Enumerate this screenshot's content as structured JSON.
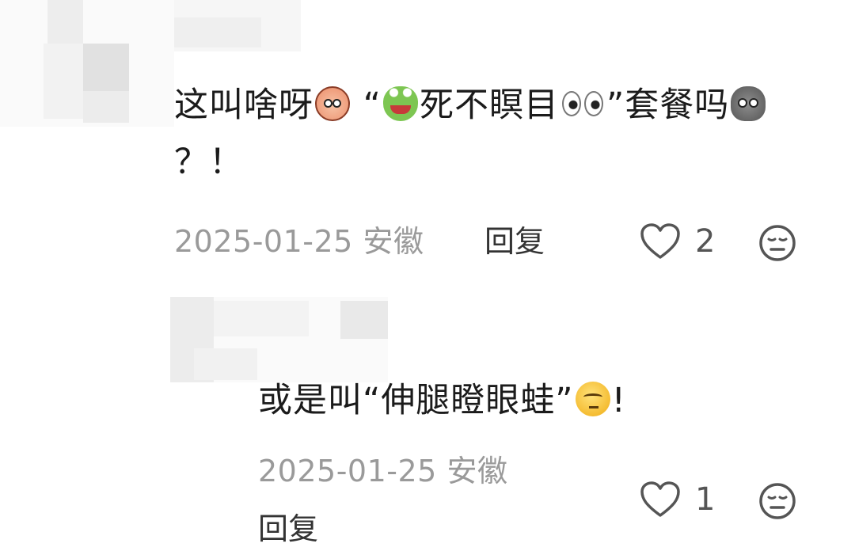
{
  "comments": [
    {
      "text_part1": "这叫啥呀",
      "text_part2": "“",
      "text_part3": "死不瞑目",
      "text_part4": "”套餐吗",
      "text_part5": "？！",
      "emojis": [
        "sweating-peach-emoji",
        "frog-emoji",
        "eyes-emoji",
        "shocked-rock-emoji"
      ],
      "date": "2025-01-25",
      "location": "安徽",
      "reply_label": "回复",
      "likes": "2"
    },
    {
      "text_part1": "或是叫“伸腿瞪眼蛙”",
      "text_part2": "!",
      "emojis": [
        "thinking-raised-eyebrow-emoji"
      ],
      "date": "2025-01-25",
      "location": "安徽",
      "reply_label": "回复",
      "likes": "1"
    }
  ],
  "colors": {
    "text": "#1b1b1b",
    "meta": "#9a9a9a",
    "icon": "#555555"
  }
}
